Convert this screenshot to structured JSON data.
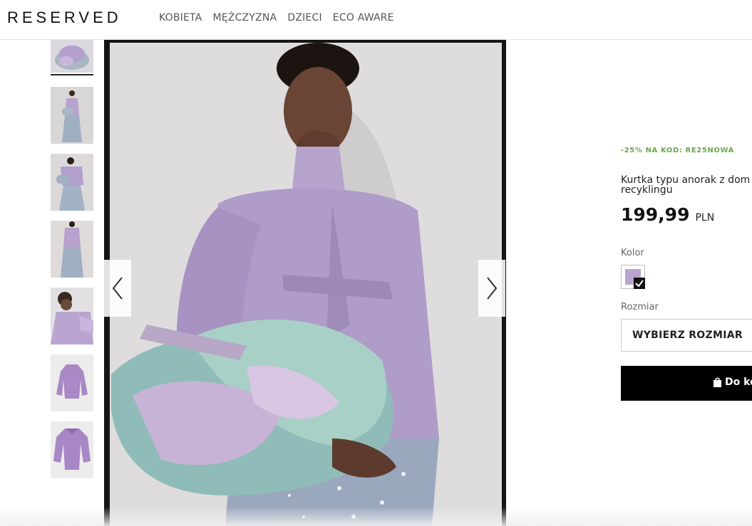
{
  "header": {
    "logo": "RESERVED",
    "nav": [
      "KOBIETA",
      "MĘŻCZYZNA",
      "DZIECI",
      "ECO AWARE"
    ]
  },
  "gallery": {
    "thumbnail_count": 7,
    "active_index": 0
  },
  "product": {
    "promo": "-25% NA KOD: RE25NOWA",
    "title_line1": "Kurtka typu anorak z dom",
    "title_line2": "recyklingu",
    "price": "199,99",
    "currency": "PLN",
    "color_label": "Kolor",
    "selected_color": "#b9a4cf",
    "size_label": "Rozmiar",
    "size_placeholder": "WYBIERZ ROZMIAR",
    "add_button": "Do ko"
  },
  "colors": {
    "promo_green": "#6aa84f",
    "button_black": "#000000",
    "lavender": "#b9a4cf"
  }
}
